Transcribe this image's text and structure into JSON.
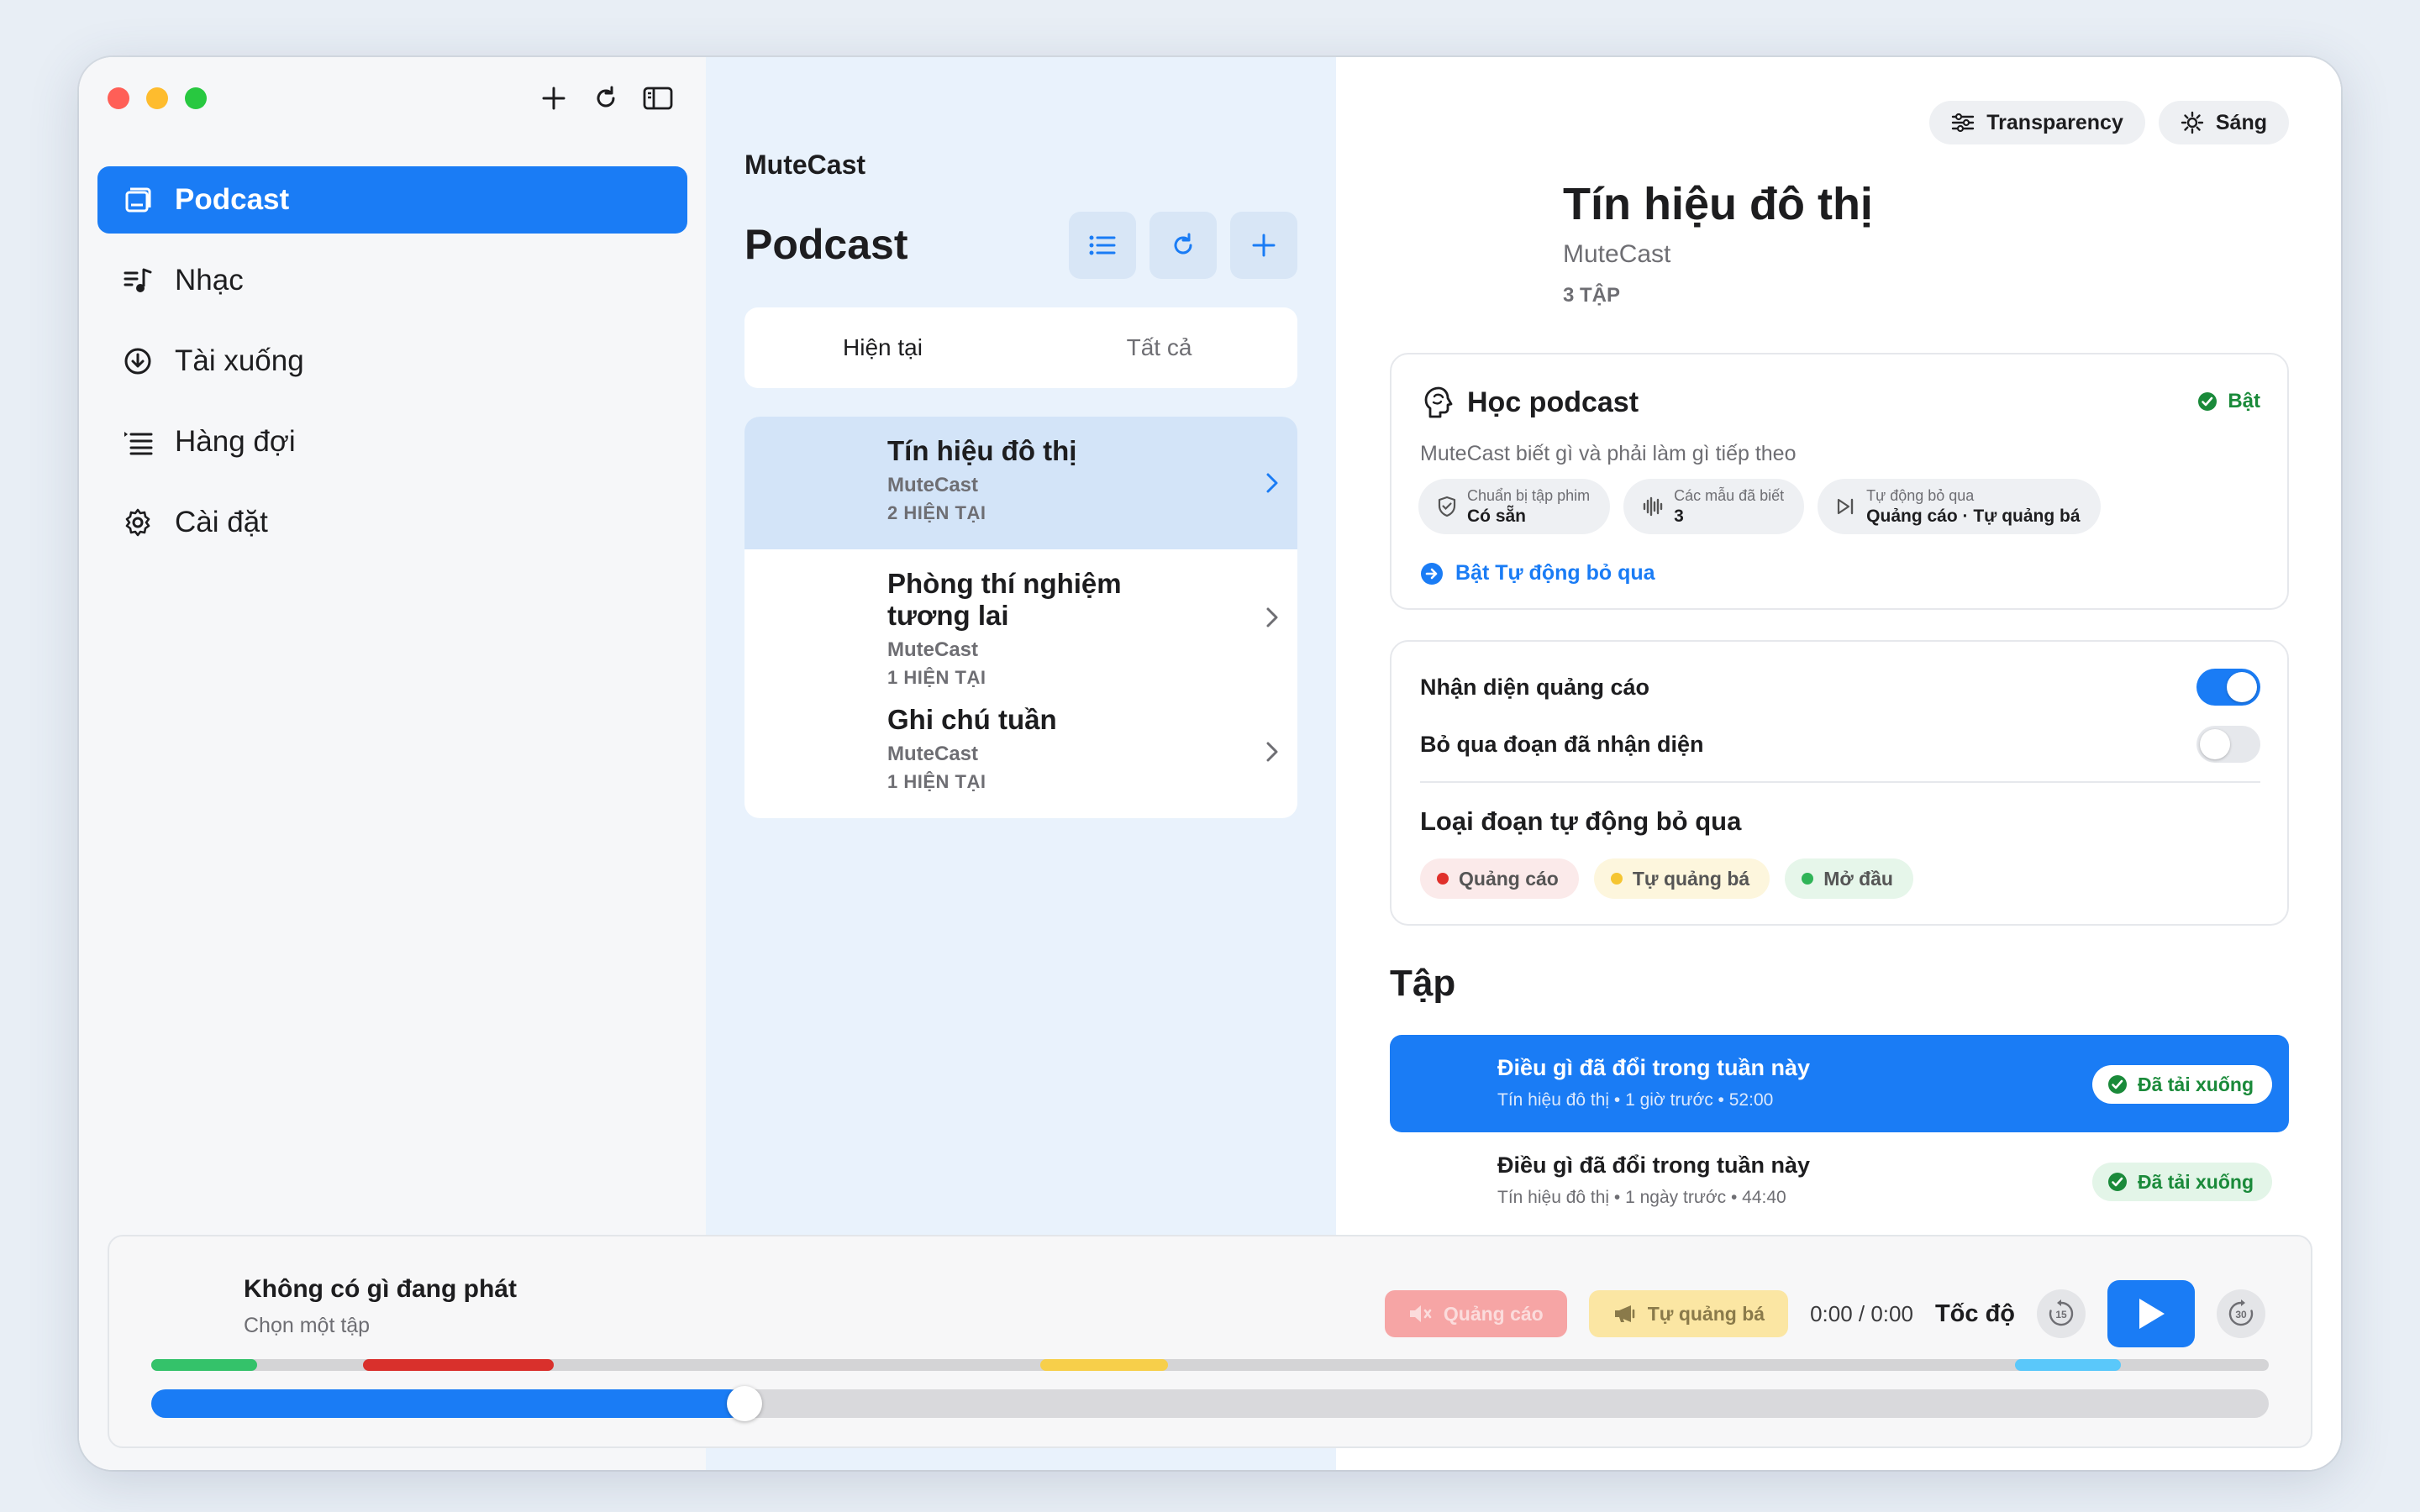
{
  "sidebar": {
    "items": [
      {
        "label": "Podcast",
        "icon": "podcast-icon",
        "active": true
      },
      {
        "label": "Nhạc",
        "icon": "music-icon",
        "active": false
      },
      {
        "label": "Tài xuống",
        "icon": "download-icon",
        "active": false
      },
      {
        "label": "Hàng đợi",
        "icon": "queue-icon",
        "active": false
      },
      {
        "label": "Cài đặt",
        "icon": "gear-icon",
        "active": false
      }
    ]
  },
  "middle": {
    "app_name": "MuteCast",
    "title": "Podcast",
    "tabs": [
      {
        "label": "Hiện tại",
        "active": true
      },
      {
        "label": "Tất cả",
        "active": false
      }
    ],
    "podcasts": [
      {
        "title": "Tín hiệu đô thị",
        "author": "MuteCast",
        "count": "2 HIỆN TẠI",
        "selected": true
      },
      {
        "title": "Phòng thí nghiệm tương lai",
        "author": "MuteCast",
        "count": "1 HIỆN TẠI",
        "selected": false
      },
      {
        "title": "Ghi chú tuần",
        "author": "MuteCast",
        "count": "1 HIỆN TẠI",
        "selected": false
      }
    ]
  },
  "right": {
    "transparency_label": "Transparency",
    "theme_label": "Sáng",
    "podcast_title": "Tín hiệu đô thị",
    "podcast_author": "MuteCast",
    "episode_count": "3 TẬP",
    "learn": {
      "title": "Học podcast",
      "status": "Bật",
      "description": "MuteCast biết gì và phải làm gì tiếp theo",
      "chips": [
        {
          "label": "Chuẩn bị tập phim",
          "value": "Có sẵn",
          "icon": "shield-check-icon"
        },
        {
          "label": "Các mẫu đã biết",
          "value": "3",
          "icon": "waveform-icon"
        },
        {
          "label": "Tự động bỏ qua",
          "value": "Quảng cáo · Tự quảng bá",
          "icon": "skip-forward-icon"
        }
      ],
      "link": "Bật Tự động bỏ qua"
    },
    "settings": {
      "detect_label": "Nhận diện quảng cáo",
      "detect_on": true,
      "skip_label": "Bỏ qua đoạn đã nhận diện",
      "skip_on": false,
      "categories_title": "Loại đoạn tự động bỏ qua",
      "categories": [
        {
          "label": "Quảng cáo",
          "color": "#e0302b",
          "bg": "#fbeaea"
        },
        {
          "label": "Tự quảng bá",
          "color": "#f5c531",
          "bg": "#fdf6dd"
        },
        {
          "label": "Mở đầu",
          "color": "#2fb457",
          "bg": "#e6f6ea"
        }
      ]
    },
    "episodes_title": "Tập",
    "episodes": [
      {
        "title": "Điều gì đã đổi trong tuần này",
        "meta": "Tín hiệu đô thị • 1 giờ trước • 52:00",
        "badge": "Đã tải xuống",
        "selected": true
      },
      {
        "title": "Điều gì đã đổi trong tuần này",
        "meta": "Tín hiệu đô thị • 1 ngày trước • 44:40",
        "badge": "Đã tải xuống",
        "selected": false
      }
    ]
  },
  "player": {
    "title": "Không có gì đang phát",
    "subtitle": "Chọn một tập",
    "skip_ad_label": "Quảng cáo",
    "skip_promo_label": "Tự quảng bá",
    "time": "0:00 / 0:00",
    "speed_label": "Tốc độ",
    "rewind_seconds": "15",
    "forward_seconds": "30",
    "progress": 0.28,
    "segments": [
      {
        "start": 0.0,
        "end": 0.05,
        "color": "#34c26a"
      },
      {
        "start": 0.1,
        "end": 0.19,
        "color": "#d9302c"
      },
      {
        "start": 0.42,
        "end": 0.48,
        "color": "#f7cf4a"
      },
      {
        "start": 0.88,
        "end": 0.93,
        "color": "#5ac8fa"
      }
    ]
  },
  "colors": {
    "accent": "#1a7cf5",
    "success": "#1a8a3a"
  }
}
